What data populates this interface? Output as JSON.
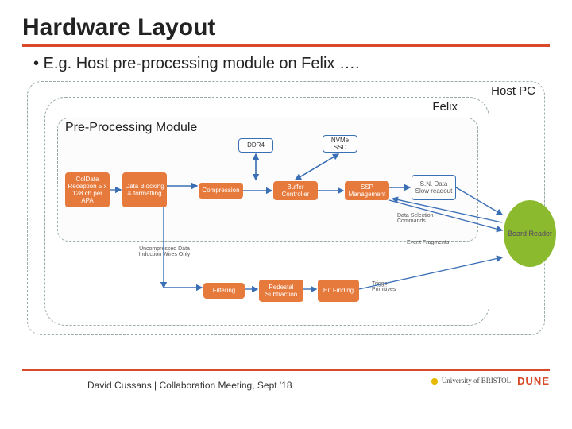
{
  "title": "Hardware Layout",
  "bullet": "E.g. Host pre-processing module on Felix ….",
  "containers": {
    "hostpc": "Host PC",
    "felix": "Felix",
    "ppm": "Pre-Processing Module"
  },
  "blocks": {
    "coldata": "ColData Reception 5 x 128 ch per APA",
    "databl": "Data Blocking & formatting",
    "compress": "Compression",
    "bufctrl": "Buffer Controller",
    "sspmgmt": "SSP Management",
    "ddr4": "DDR4",
    "nvme": "NVMe SSD",
    "snreadout": "S.N. Data Slow readout",
    "filter": "Filtering",
    "pedsub": "Pedestal Subtraction",
    "hitfind": "Hit Finding",
    "boardreader": "Board Reader"
  },
  "annot": {
    "uncomp": "Uncompressed Data Induction Wires Only",
    "datasel": "Data Selection Commands",
    "evtfrag": "Event Fragments",
    "trigprim": "Trigger Primitives"
  },
  "footer": "David Cussans | Collaboration Meeting, Sept '18",
  "logos": {
    "bristol": "University of BRISTOL",
    "dune": "DUNE"
  }
}
